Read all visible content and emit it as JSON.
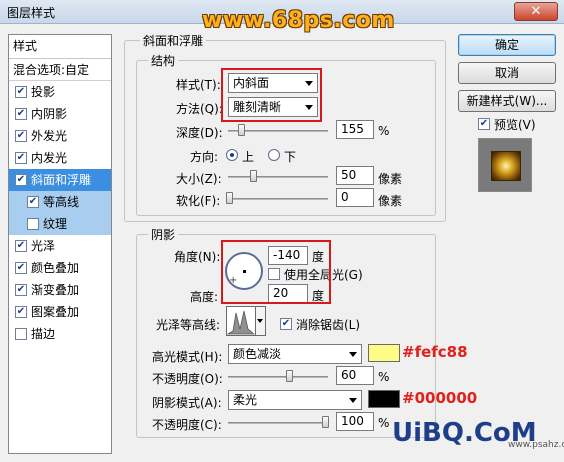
{
  "window": {
    "title": "图层样式",
    "close_glyph": "✕"
  },
  "watermark": {
    "top": "www.68ps.com",
    "bottom": "UiBQ.CoM",
    "bottom_sub": "www.psahz.com"
  },
  "left_panel": {
    "header": "样式",
    "blend_options": "混合选项:自定",
    "items": [
      {
        "label": "投影",
        "checked": true
      },
      {
        "label": "内阴影",
        "checked": true
      },
      {
        "label": "外发光",
        "checked": true
      },
      {
        "label": "内发光",
        "checked": true
      },
      {
        "label": "斜面和浮雕",
        "checked": true,
        "selected": true
      },
      {
        "label": "等高线",
        "checked": true,
        "sub": true
      },
      {
        "label": "纹理",
        "checked": false,
        "sub": true
      },
      {
        "label": "光泽",
        "checked": true
      },
      {
        "label": "颜色叠加",
        "checked": true
      },
      {
        "label": "渐变叠加",
        "checked": true
      },
      {
        "label": "图案叠加",
        "checked": true
      },
      {
        "label": "描边",
        "checked": false
      }
    ]
  },
  "bevel": {
    "group_title": "斜面和浮雕",
    "structure_title": "结构",
    "style_label": "样式(T):",
    "style_value": "内斜面",
    "technique_label": "方法(Q):",
    "technique_value": "雕刻清晰",
    "depth_label": "深度(D):",
    "depth_value": "155",
    "depth_unit": "%",
    "direction_label": "方向:",
    "dir_up": "上",
    "dir_down": "下",
    "size_label": "大小(Z):",
    "size_value": "50",
    "size_unit": "像素",
    "soften_label": "软化(F):",
    "soften_value": "0",
    "soften_unit": "像素"
  },
  "shading": {
    "title": "阴影",
    "angle_label": "角度(N):",
    "angle_value": "-140",
    "angle_unit": "度",
    "global_light": "使用全局光(G)",
    "altitude_label": "高度:",
    "altitude_value": "20",
    "altitude_unit": "度",
    "gloss_contour_label": "光泽等高线:",
    "anti_alias": "消除锯齿(L)",
    "highlight_mode_label": "高光模式(H):",
    "highlight_mode_value": "颜色减淡",
    "highlight_color": "#fefc88",
    "highlight_annotation": "#fefc88",
    "highlight_opacity_label": "不透明度(O):",
    "highlight_opacity_value": "60",
    "shadow_mode_label": "阴影模式(A):",
    "shadow_mode_value": "柔光",
    "shadow_color": "#000000",
    "shadow_annotation": "#000000",
    "shadow_opacity_label": "不透明度(C):",
    "shadow_opacity_value": "100",
    "percent": "%"
  },
  "buttons": {
    "ok": "确定",
    "cancel": "取消",
    "new_style": "新建样式(W)...",
    "preview": "预览(V)"
  }
}
